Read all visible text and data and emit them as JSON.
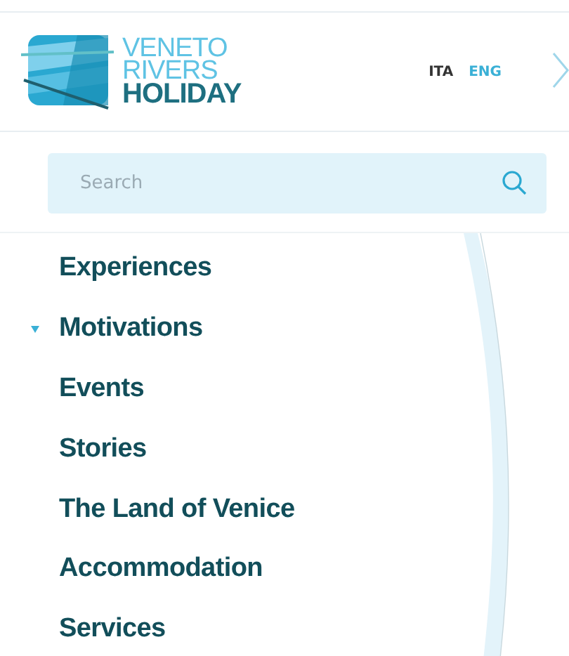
{
  "logo": {
    "line_1": "VENETO",
    "line_2": "RIVERS",
    "line_3": "HOLIDAY"
  },
  "languages": [
    {
      "label": "ITA",
      "selected": false
    },
    {
      "label": "ENG",
      "selected": true
    }
  ],
  "search": {
    "placeholder": "Search"
  },
  "menu": [
    {
      "label": "Experiences",
      "expanded": false
    },
    {
      "label": "Motivations",
      "expanded": true
    },
    {
      "label": "Events",
      "expanded": false
    },
    {
      "label": "Stories",
      "expanded": false
    },
    {
      "label": "The Land of Venice",
      "expanded": false
    },
    {
      "label": "Accommodation",
      "expanded": false
    },
    {
      "label": "Services",
      "expanded": false
    }
  ]
}
